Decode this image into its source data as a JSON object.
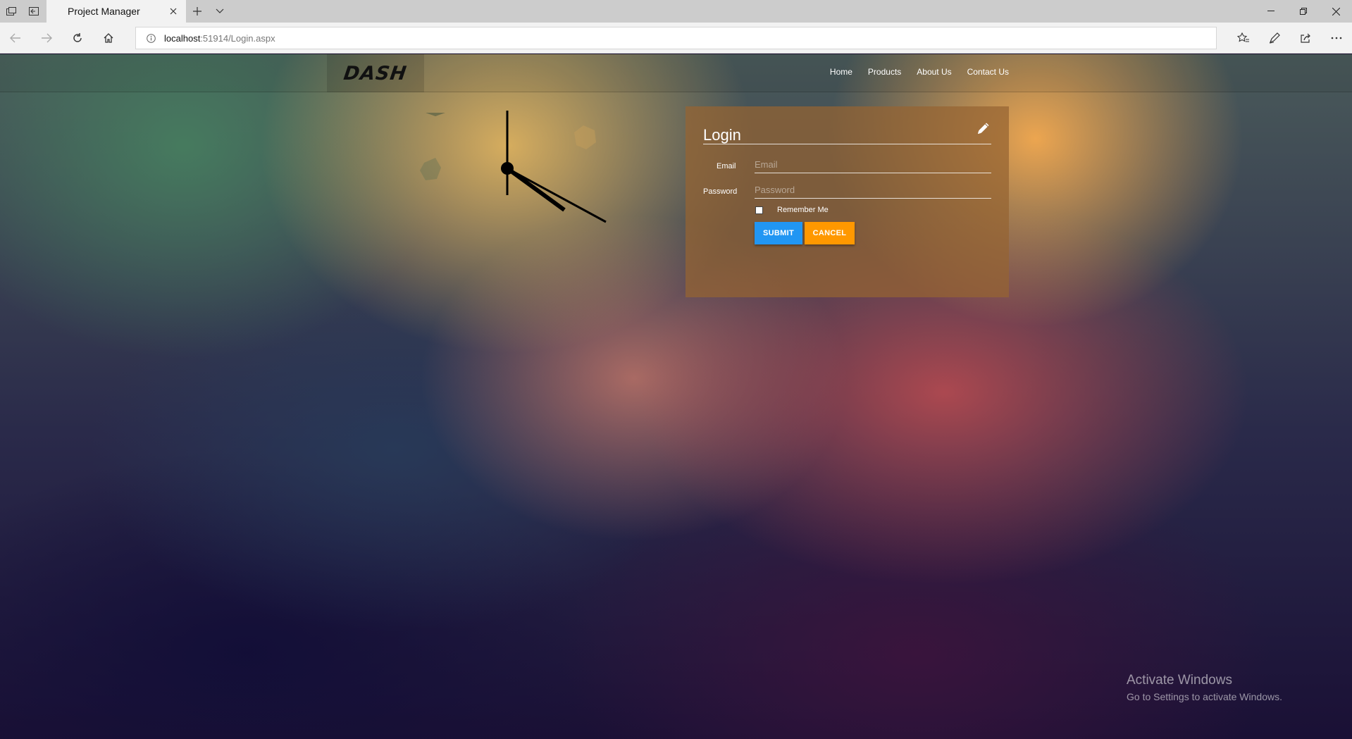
{
  "browser": {
    "tab_title": "Project Manager",
    "url_host": "localhost",
    "url_rest": ":51914/Login.aspx"
  },
  "site": {
    "logo": "DASH",
    "nav": [
      "Home",
      "Products",
      "About Us",
      "Contact Us"
    ]
  },
  "login": {
    "title": "Login",
    "email_label": "Email",
    "email_placeholder": "Email",
    "password_label": "Password",
    "password_placeholder": "Password",
    "remember_label": "Remember Me",
    "submit_label": "SUBMIT",
    "cancel_label": "CANCEL"
  },
  "watermark": {
    "line1": "Activate Windows",
    "line2": "Go to Settings to activate Windows."
  },
  "colors": {
    "submit": "#2196f3",
    "cancel": "#ff9800"
  }
}
